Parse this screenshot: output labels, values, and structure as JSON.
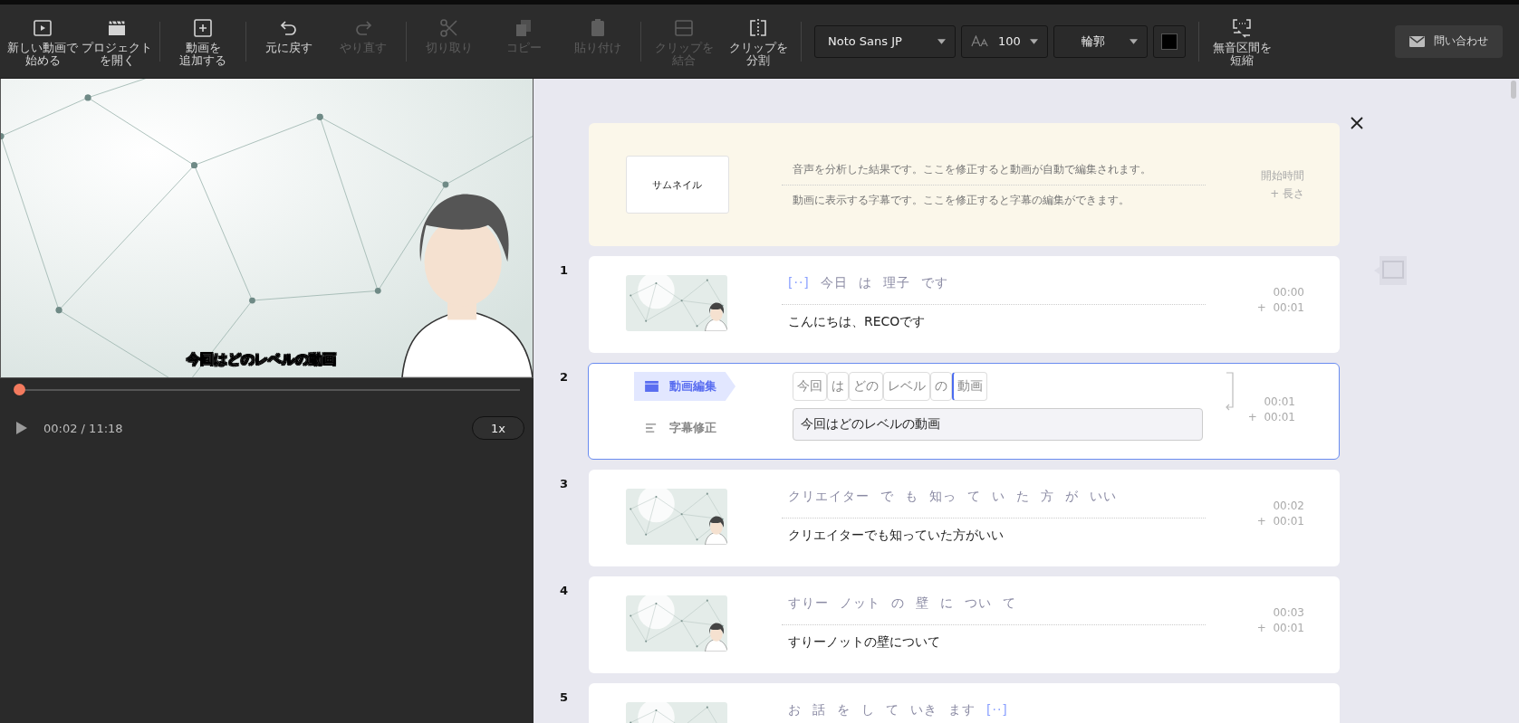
{
  "toolbar": {
    "buttons": [
      {
        "kind": "new",
        "label": [
          "新しい動画で",
          "始める"
        ],
        "disabled": false
      },
      {
        "kind": "open",
        "label": [
          "プロジェクト",
          "を開く"
        ],
        "disabled": false
      },
      {
        "kind": "add",
        "label": [
          "動画を",
          "追加する"
        ],
        "disabled": false
      },
      {
        "kind": "undo",
        "label": [
          "元に戻す"
        ],
        "disabled": false
      },
      {
        "kind": "redo",
        "label": [
          "やり直す"
        ],
        "disabled": true
      },
      {
        "kind": "cut",
        "label": [
          "切り取り"
        ],
        "disabled": true
      },
      {
        "kind": "copy",
        "label": [
          "コピー"
        ],
        "disabled": true
      },
      {
        "kind": "paste",
        "label": [
          "貼り付け"
        ],
        "disabled": true
      },
      {
        "kind": "merge",
        "label": [
          "クリップを",
          "結合"
        ],
        "disabled": true
      },
      {
        "kind": "split",
        "label": [
          "クリップを",
          "分割"
        ],
        "disabled": false
      }
    ],
    "font": "Noto Sans JP",
    "size": "100",
    "outline": "輪郭",
    "color": "#000000",
    "shorten": [
      "無音区間を",
      "短縮"
    ],
    "contact": "問い合わせ"
  },
  "player": {
    "caption": "今回はどのレベルの動画",
    "level": 0.003,
    "time": "00:02 / 11:18",
    "speed": "1x"
  },
  "header": {
    "thumbnail": "サムネイル",
    "info_1": "音声を分析した結果です。ここを修正すると動画が自動で編集されます。",
    "info_2": "動画に表示する字幕です。ここを修正すると字幕の編集ができます。",
    "start_label": "開始時間",
    "length_label": "+ 長さ"
  },
  "clips": [
    {
      "number": "1",
      "selected": false,
      "words": [
        {
          "kind": "silence",
          "text": "[··]"
        },
        {
          "kind": "word",
          "text": "今日"
        },
        {
          "kind": "word",
          "text": "は"
        },
        {
          "kind": "word",
          "text": "理子"
        },
        {
          "kind": "word",
          "text": "です"
        }
      ],
      "subtitle": "こんにちは、RECOです",
      "start": "00:00",
      "length": "+  00:01"
    },
    {
      "number": "2",
      "selected": true,
      "tabs": [
        {
          "label": "動画編集",
          "selected": true
        },
        {
          "label": "字幕修正",
          "selected": false
        }
      ],
      "words": [
        {
          "kind": "word",
          "text": "今回",
          "cursor": false
        },
        {
          "kind": "word",
          "text": "は",
          "cursor": false
        },
        {
          "kind": "word",
          "text": "どの",
          "cursor": false
        },
        {
          "kind": "word",
          "text": "レベル",
          "cursor": false
        },
        {
          "kind": "word",
          "text": "の",
          "cursor": false
        },
        {
          "kind": "word",
          "text": "動画",
          "cursor": true
        }
      ],
      "subtitle": "今回はどのレベルの動画",
      "start": "00:01",
      "length": "+  00:01"
    },
    {
      "number": "3",
      "selected": false,
      "words": [
        {
          "kind": "word",
          "text": "クリエイター"
        },
        {
          "kind": "word",
          "text": "で"
        },
        {
          "kind": "word",
          "text": "も"
        },
        {
          "kind": "word",
          "text": "知っ"
        },
        {
          "kind": "word",
          "text": "て"
        },
        {
          "kind": "word",
          "text": "い"
        },
        {
          "kind": "word",
          "text": "た"
        },
        {
          "kind": "word",
          "text": "方"
        },
        {
          "kind": "word",
          "text": "が"
        },
        {
          "kind": "word",
          "text": "いい"
        }
      ],
      "subtitle": "クリエイターでも知っていた方がいい",
      "start": "00:02",
      "length": "+  00:01"
    },
    {
      "number": "4",
      "selected": false,
      "words": [
        {
          "kind": "word",
          "text": "すりー"
        },
        {
          "kind": "word",
          "text": "ノット"
        },
        {
          "kind": "word",
          "text": "の"
        },
        {
          "kind": "word",
          "text": "壁"
        },
        {
          "kind": "word",
          "text": "に"
        },
        {
          "kind": "word",
          "text": "つい"
        },
        {
          "kind": "word",
          "text": "て"
        }
      ],
      "subtitle": "すりーノットの壁について",
      "start": "00:03",
      "length": "+  00:01"
    },
    {
      "number": "5",
      "selected": false,
      "words": [
        {
          "kind": "word",
          "text": "お"
        },
        {
          "kind": "word",
          "text": "話"
        },
        {
          "kind": "word",
          "text": "を"
        },
        {
          "kind": "word",
          "text": "し"
        },
        {
          "kind": "word",
          "text": "て"
        },
        {
          "kind": "word",
          "text": "いき"
        },
        {
          "kind": "word",
          "text": "ます"
        },
        {
          "kind": "silence",
          "text": "[··]"
        }
      ]
    }
  ]
}
